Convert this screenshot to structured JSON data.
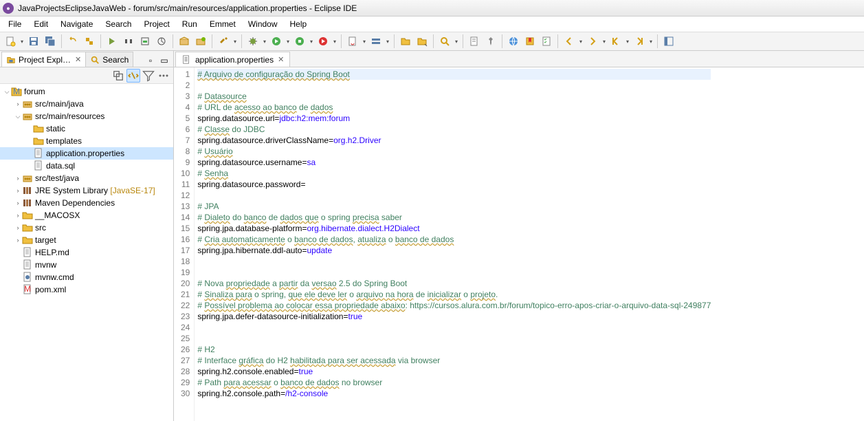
{
  "window": {
    "title": "JavaProjectsEclipseJavaWeb - forum/src/main/resources/application.properties - Eclipse IDE"
  },
  "menu": [
    "File",
    "Edit",
    "Navigate",
    "Search",
    "Project",
    "Run",
    "Emmet",
    "Window",
    "Help"
  ],
  "left": {
    "tabs": [
      {
        "label": "Project Expl…",
        "active": true,
        "closable": true
      },
      {
        "label": "Search",
        "active": false,
        "closable": false
      }
    ],
    "tree": [
      {
        "d": 0,
        "exp": "open",
        "icon": "project",
        "label": "forum"
      },
      {
        "d": 1,
        "exp": "closed",
        "icon": "pkgroot",
        "label": "src/main/java"
      },
      {
        "d": 1,
        "exp": "open",
        "icon": "pkgroot",
        "label": "src/main/resources"
      },
      {
        "d": 2,
        "exp": "none",
        "icon": "folder",
        "label": "static"
      },
      {
        "d": 2,
        "exp": "none",
        "icon": "folder",
        "label": "templates"
      },
      {
        "d": 2,
        "exp": "none",
        "icon": "file",
        "label": "application.properties",
        "selected": true
      },
      {
        "d": 2,
        "exp": "none",
        "icon": "file",
        "label": "data.sql"
      },
      {
        "d": 1,
        "exp": "closed",
        "icon": "pkgroot",
        "label": "src/test/java"
      },
      {
        "d": 1,
        "exp": "closed",
        "icon": "lib",
        "label": "JRE System Library",
        "deco": "[JavaSE-17]"
      },
      {
        "d": 1,
        "exp": "closed",
        "icon": "lib",
        "label": "Maven Dependencies"
      },
      {
        "d": 1,
        "exp": "closed",
        "icon": "folder",
        "label": "__MACOSX"
      },
      {
        "d": 1,
        "exp": "closed",
        "icon": "folder",
        "label": "src"
      },
      {
        "d": 1,
        "exp": "closed",
        "icon": "folder",
        "label": "target"
      },
      {
        "d": 1,
        "exp": "none",
        "icon": "file",
        "label": "HELP.md"
      },
      {
        "d": 1,
        "exp": "none",
        "icon": "file",
        "label": "mvnw"
      },
      {
        "d": 1,
        "exp": "none",
        "icon": "filecmd",
        "label": "mvnw.cmd"
      },
      {
        "d": 1,
        "exp": "none",
        "icon": "filexml",
        "label": "pom.xml"
      }
    ]
  },
  "editor": {
    "tab": {
      "label": "application.properties"
    },
    "lines": [
      {
        "n": 1,
        "hl": true,
        "seg": [
          {
            "t": "# Arquivo de configuração do Spring Boot",
            "c": "c-comment underline"
          }
        ]
      },
      {
        "n": 2,
        "seg": []
      },
      {
        "n": 3,
        "seg": [
          {
            "t": "# ",
            "c": "c-comment"
          },
          {
            "t": "Datasource",
            "c": "c-comment underline"
          }
        ]
      },
      {
        "n": 4,
        "seg": [
          {
            "t": "# URL de ",
            "c": "c-comment"
          },
          {
            "t": "acesso ao banco",
            "c": "c-comment underline"
          },
          {
            "t": " de ",
            "c": "c-comment"
          },
          {
            "t": "dados",
            "c": "c-comment underline"
          }
        ]
      },
      {
        "n": 5,
        "seg": [
          {
            "t": "spring.datasource.url",
            "c": "c-key"
          },
          {
            "t": "=",
            "c": "c-eq"
          },
          {
            "t": "jdbc:h2:mem:forum",
            "c": "c-val"
          }
        ]
      },
      {
        "n": 6,
        "seg": [
          {
            "t": "# ",
            "c": "c-comment"
          },
          {
            "t": "Classe",
            "c": "c-comment underline"
          },
          {
            "t": " do JDBC",
            "c": "c-comment"
          }
        ]
      },
      {
        "n": 7,
        "seg": [
          {
            "t": "spring.datasource.driverClassName",
            "c": "c-key"
          },
          {
            "t": "=",
            "c": "c-eq"
          },
          {
            "t": "org.h2.Driver",
            "c": "c-val"
          }
        ]
      },
      {
        "n": 8,
        "seg": [
          {
            "t": "# ",
            "c": "c-comment"
          },
          {
            "t": "Usuário",
            "c": "c-comment underline"
          }
        ]
      },
      {
        "n": 9,
        "seg": [
          {
            "t": "spring.datasource.username",
            "c": "c-key"
          },
          {
            "t": "=",
            "c": "c-eq"
          },
          {
            "t": "sa",
            "c": "c-val"
          }
        ]
      },
      {
        "n": 10,
        "seg": [
          {
            "t": "# ",
            "c": "c-comment"
          },
          {
            "t": "Senha",
            "c": "c-comment underline"
          }
        ]
      },
      {
        "n": 11,
        "seg": [
          {
            "t": "spring.datasource.password",
            "c": "c-key"
          },
          {
            "t": "=",
            "c": "c-eq"
          }
        ]
      },
      {
        "n": 12,
        "seg": []
      },
      {
        "n": 13,
        "seg": [
          {
            "t": "# JPA",
            "c": "c-comment"
          }
        ]
      },
      {
        "n": 14,
        "seg": [
          {
            "t": "# ",
            "c": "c-comment"
          },
          {
            "t": "Dialeto",
            "c": "c-comment underline"
          },
          {
            "t": " do ",
            "c": "c-comment"
          },
          {
            "t": "banco",
            "c": "c-comment underline"
          },
          {
            "t": " de ",
            "c": "c-comment"
          },
          {
            "t": "dados que",
            "c": "c-comment underline"
          },
          {
            "t": " o spring ",
            "c": "c-comment"
          },
          {
            "t": "precisa",
            "c": "c-comment underline"
          },
          {
            "t": " saber",
            "c": "c-comment"
          }
        ]
      },
      {
        "n": 15,
        "seg": [
          {
            "t": "spring.jpa.database-platform",
            "c": "c-key"
          },
          {
            "t": "=",
            "c": "c-eq"
          },
          {
            "t": "org.hibernate.dialect.H2Dialect",
            "c": "c-val"
          }
        ]
      },
      {
        "n": 16,
        "seg": [
          {
            "t": "# ",
            "c": "c-comment"
          },
          {
            "t": "Cria automaticamente",
            "c": "c-comment underline"
          },
          {
            "t": " o ",
            "c": "c-comment"
          },
          {
            "t": "banco de dados",
            "c": "c-comment underline"
          },
          {
            "t": ", ",
            "c": "c-comment"
          },
          {
            "t": "atualiza",
            "c": "c-comment underline"
          },
          {
            "t": " o ",
            "c": "c-comment"
          },
          {
            "t": "banco de dados",
            "c": "c-comment underline"
          }
        ]
      },
      {
        "n": 17,
        "seg": [
          {
            "t": "spring.jpa.hibernate.ddl-auto",
            "c": "c-key"
          },
          {
            "t": "=",
            "c": "c-eq"
          },
          {
            "t": "update",
            "c": "c-val"
          }
        ]
      },
      {
        "n": 18,
        "seg": []
      },
      {
        "n": 19,
        "seg": []
      },
      {
        "n": 20,
        "seg": [
          {
            "t": "# Nova ",
            "c": "c-comment"
          },
          {
            "t": "propriedade",
            "c": "c-comment underline"
          },
          {
            "t": " a ",
            "c": "c-comment"
          },
          {
            "t": "partir",
            "c": "c-comment underline"
          },
          {
            "t": " da ",
            "c": "c-comment"
          },
          {
            "t": "versao",
            "c": "c-comment underline"
          },
          {
            "t": " 2.5 do Spring Boot",
            "c": "c-comment"
          }
        ]
      },
      {
        "n": 21,
        "seg": [
          {
            "t": "# ",
            "c": "c-comment"
          },
          {
            "t": "Sinaliza para",
            "c": "c-comment underline"
          },
          {
            "t": " o spring, ",
            "c": "c-comment"
          },
          {
            "t": "que ele deve ler",
            "c": "c-comment underline"
          },
          {
            "t": " o ",
            "c": "c-comment"
          },
          {
            "t": "arquivo na hora",
            "c": "c-comment underline"
          },
          {
            "t": " de ",
            "c": "c-comment"
          },
          {
            "t": "inicializar",
            "c": "c-comment underline"
          },
          {
            "t": " o ",
            "c": "c-comment"
          },
          {
            "t": "projeto",
            "c": "c-comment underline"
          },
          {
            "t": ".",
            "c": "c-comment"
          }
        ]
      },
      {
        "n": 22,
        "seg": [
          {
            "t": "# ",
            "c": "c-comment"
          },
          {
            "t": "Possível problema ao colocar essa propriedade abaixo",
            "c": "c-comment underline"
          },
          {
            "t": ": ",
            "c": "c-comment"
          },
          {
            "t": "https://cursos.alura.com.br/forum/topico-erro-apos-criar-o-arquivo-data-sql-249877",
            "c": "c-url"
          }
        ]
      },
      {
        "n": 23,
        "seg": [
          {
            "t": "spring.jpa.defer-datasource-initialization",
            "c": "c-key"
          },
          {
            "t": "=",
            "c": "c-eq"
          },
          {
            "t": "true",
            "c": "c-val"
          }
        ]
      },
      {
        "n": 24,
        "seg": []
      },
      {
        "n": 25,
        "seg": []
      },
      {
        "n": 26,
        "seg": [
          {
            "t": "# H2",
            "c": "c-comment"
          }
        ]
      },
      {
        "n": 27,
        "seg": [
          {
            "t": "# Interface ",
            "c": "c-comment"
          },
          {
            "t": "gráfica",
            "c": "c-comment underline"
          },
          {
            "t": " do H2 ",
            "c": "c-comment"
          },
          {
            "t": "habilitada para ser acessada",
            "c": "c-comment underline"
          },
          {
            "t": " via browser",
            "c": "c-comment"
          }
        ]
      },
      {
        "n": 28,
        "seg": [
          {
            "t": "spring.h2.console.enabled",
            "c": "c-key"
          },
          {
            "t": "=",
            "c": "c-eq"
          },
          {
            "t": "true",
            "c": "c-val"
          }
        ]
      },
      {
        "n": 29,
        "seg": [
          {
            "t": "# Path ",
            "c": "c-comment"
          },
          {
            "t": "para acessar",
            "c": "c-comment underline"
          },
          {
            "t": " o ",
            "c": "c-comment"
          },
          {
            "t": "banco de dados",
            "c": "c-comment underline"
          },
          {
            "t": " no browser",
            "c": "c-comment"
          }
        ]
      },
      {
        "n": 30,
        "seg": [
          {
            "t": "spring.h2.console.path",
            "c": "c-key"
          },
          {
            "t": "=",
            "c": "c-eq"
          },
          {
            "t": "/h2-console",
            "c": "c-val"
          }
        ]
      }
    ]
  },
  "toolbar_icons": [
    {
      "n": "new",
      "d": true
    },
    {
      "n": "save"
    },
    {
      "n": "saveall"
    },
    {
      "sep": true
    },
    {
      "n": "undo"
    },
    {
      "n": "redo"
    },
    {
      "sep": true
    },
    {
      "n": "debug-last"
    },
    {
      "n": "run-last"
    },
    {
      "n": "coverage"
    },
    {
      "n": "run-external"
    },
    {
      "sep": true
    },
    {
      "n": "new-pkg"
    },
    {
      "n": "new-class"
    },
    {
      "sep": true
    },
    {
      "n": "build",
      "d": true
    },
    {
      "sep": true
    },
    {
      "n": "debug",
      "d": true,
      "c": "#7a9e3f"
    },
    {
      "n": "run",
      "d": true,
      "c": "#4caf50"
    },
    {
      "n": "coverage2",
      "d": true
    },
    {
      "n": "runext",
      "d": true,
      "c": "#d33"
    },
    {
      "sep": true
    },
    {
      "n": "newjava",
      "d": true
    },
    {
      "n": "newserver",
      "d": true
    },
    {
      "sep": true
    },
    {
      "n": "open"
    },
    {
      "n": "openres"
    },
    {
      "sep": true
    },
    {
      "n": "search",
      "d": true
    },
    {
      "sep": true
    },
    {
      "n": "annotate"
    },
    {
      "n": "pin"
    },
    {
      "sep": true
    },
    {
      "n": "browser"
    },
    {
      "n": "bookmark"
    },
    {
      "n": "task"
    },
    {
      "sep": true
    },
    {
      "n": "back",
      "d": true
    },
    {
      "n": "fwd",
      "d": true
    },
    {
      "n": "home",
      "d": true
    },
    {
      "n": "last",
      "d": true
    },
    {
      "sep": true
    },
    {
      "n": "persp"
    }
  ]
}
